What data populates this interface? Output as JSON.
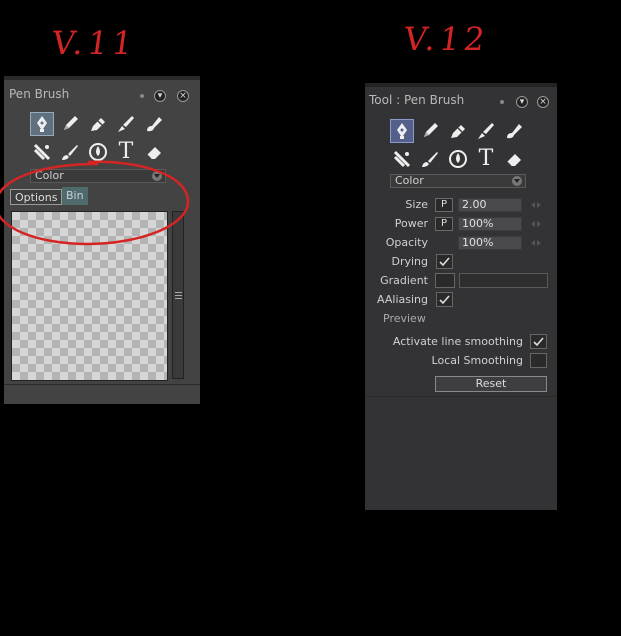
{
  "annotations": {
    "v11": "V.11",
    "v12": "V.12"
  },
  "colors": {
    "annotation_red": "#d42424",
    "selected_tool": "#5f7080",
    "panel_v11": "#434343",
    "panel_v12": "#333336"
  },
  "v11": {
    "title": "Pen Brush",
    "tools": [
      "pen-tool-icon",
      "pencil-icon",
      "marker-icon",
      "brush-icon",
      "airbrush-icon",
      "spray-icon",
      "paint-brush-icon",
      "water-drop-icon",
      "text-tool-icon",
      "eraser-icon"
    ],
    "text_tool_glyph": "T",
    "dropdown_value": "Color",
    "tabs": {
      "options": "Options",
      "bin": "Bin"
    }
  },
  "v12": {
    "title": "Tool : Pen Brush",
    "text_tool_glyph": "T",
    "dropdown_value": "Color",
    "size": {
      "label": "Size",
      "pressure": "P",
      "value": "2.00"
    },
    "power": {
      "label": "Power",
      "pressure": "P",
      "value": "100%"
    },
    "opacity": {
      "label": "Opacity",
      "value": "100%"
    },
    "drying": {
      "label": "Drying",
      "checked": true
    },
    "gradient": {
      "label": "Gradient"
    },
    "aaliasing": {
      "label": "AAliasing",
      "checked": true
    },
    "preview": "Preview",
    "line_smoothing": {
      "label": "Activate line smoothing",
      "checked": true
    },
    "local_smoothing": {
      "label": "Local Smoothing",
      "checked": false
    },
    "reset": "Reset"
  }
}
